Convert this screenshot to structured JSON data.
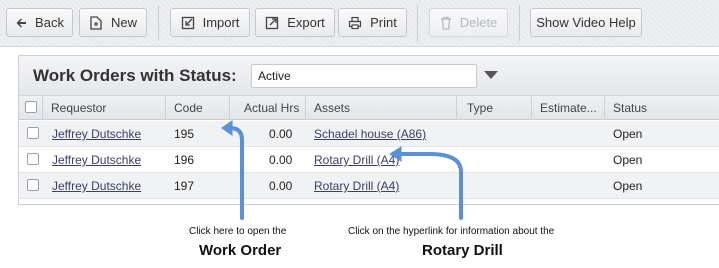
{
  "toolbar": {
    "back": "Back",
    "new": "New",
    "import": "Import",
    "export": "Export",
    "print": "Print",
    "delete": "Delete",
    "video_help": "Show Video Help"
  },
  "panel": {
    "title": "Work Orders with Status:",
    "status_value": "Active"
  },
  "table": {
    "columns": [
      "Requestor",
      "Code",
      "Actual Hrs",
      "Assets",
      "Type",
      "Estimate...",
      "Status"
    ],
    "rows": [
      {
        "requestor": "Jeffrey Dutschke",
        "code": "195",
        "actual_hrs": "0.00",
        "asset": "Schadel house (A86)",
        "type": "",
        "estimate": "",
        "status": "Open"
      },
      {
        "requestor": "Jeffrey Dutschke",
        "code": "196",
        "actual_hrs": "0.00",
        "asset": "Rotary Drill (A4)",
        "type": "",
        "estimate": "",
        "status": "Open"
      },
      {
        "requestor": "Jeffrey Dutschke",
        "code": "197",
        "actual_hrs": "0.00",
        "asset": "Rotary Drill (A4)",
        "type": "",
        "estimate": "",
        "status": "Open"
      }
    ]
  },
  "annotations": {
    "left_small": "Click here to open the",
    "left_big": "Work Order",
    "right_small": "Click on the hyperlink for information about the",
    "right_big": "Rotary Drill",
    "arrow_color": "#5b8fd6"
  }
}
